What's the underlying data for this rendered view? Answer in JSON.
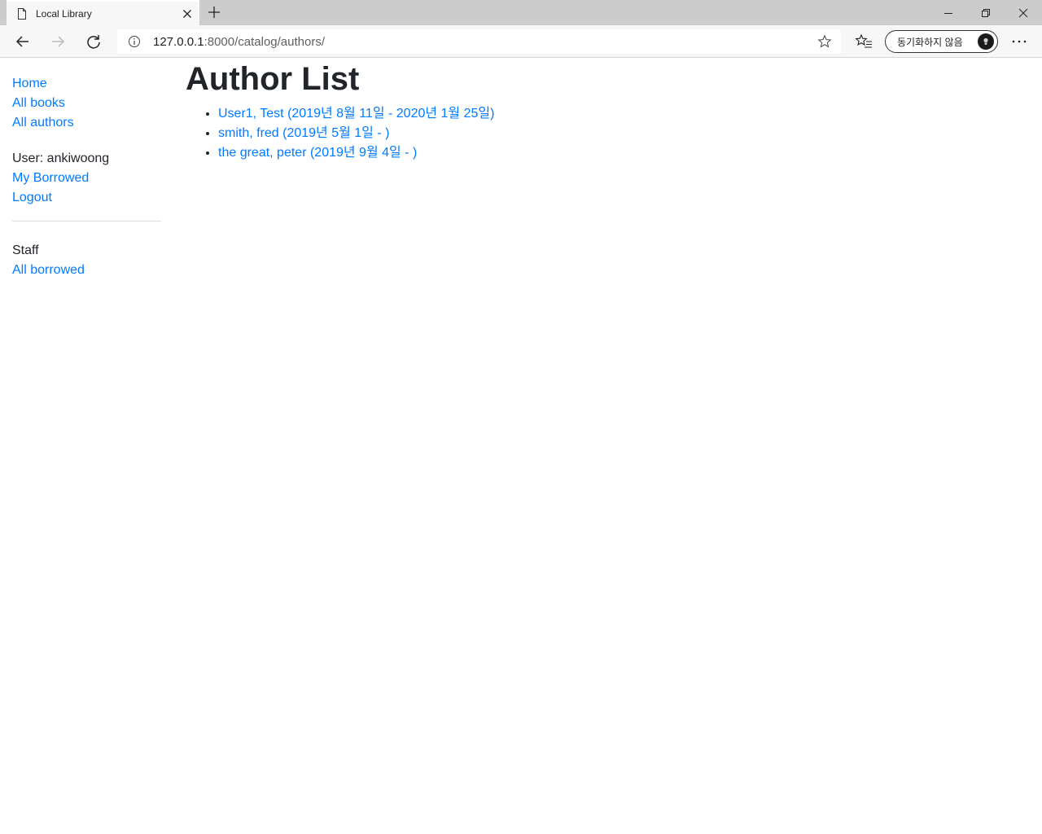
{
  "browser": {
    "tab_title": "Local Library",
    "url_host": "127.0.0.1",
    "url_rest": ":8000/catalog/authors/",
    "sync_label": "동기화하지 않음",
    "icons": {
      "favicon": "page-icon",
      "tab_close": "close-icon",
      "new_tab": "plus-icon",
      "back": "arrow-left-icon",
      "forward": "arrow-right-icon",
      "refresh": "refresh-icon",
      "info": "info-icon",
      "star": "star-icon",
      "favorites": "favorites-list-icon",
      "more": "ellipsis-icon",
      "minimize": "minimize-icon",
      "maximize": "restore-icon",
      "close": "window-close-icon"
    }
  },
  "sidebar": {
    "links": [
      {
        "label": "Home"
      },
      {
        "label": "All books"
      },
      {
        "label": "All authors"
      }
    ],
    "user_label": "User: ankiwoong",
    "user_links": [
      {
        "label": "My Borrowed"
      },
      {
        "label": "Logout"
      }
    ],
    "staff_label": "Staff",
    "staff_links": [
      {
        "label": "All borrowed"
      }
    ]
  },
  "main": {
    "title": "Author List",
    "authors": [
      {
        "label": "User1, Test (2019년 8월 11일 - 2020년 1월 25일)"
      },
      {
        "label": "smith, fred (2019년 5월 1일 - )"
      },
      {
        "label": "the great, peter (2019년 9월 4일 - )"
      }
    ]
  },
  "colors": {
    "link": "#007bff",
    "text": "#212529",
    "chrome_bg": "#cccccc",
    "toolbar_bg": "#f7f7f7"
  }
}
